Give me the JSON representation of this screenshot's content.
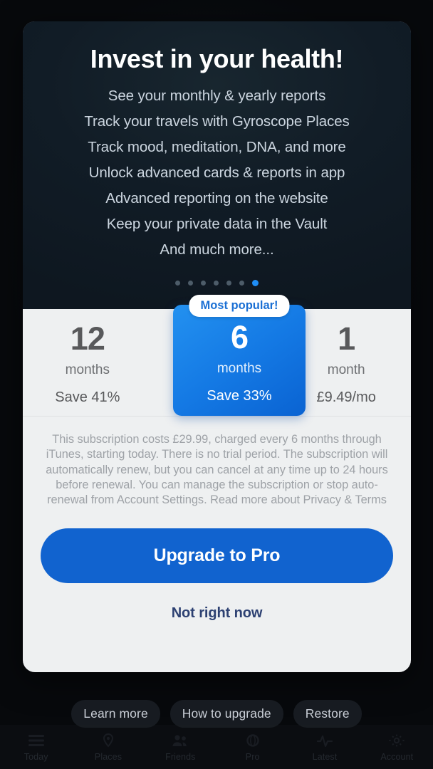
{
  "promo": {
    "title": "Invest in your health!",
    "features": [
      "See your monthly & yearly reports",
      "Track your travels with Gyroscope Places",
      "Track mood, meditation, DNA, and more",
      "Unlock advanced cards & reports in app",
      "Advanced reporting on the website",
      "Keep your private data in the Vault",
      "And much more..."
    ],
    "pager": {
      "total": 7,
      "active_index": 6
    }
  },
  "plans": {
    "badge_label": "Most popular!",
    "options": [
      {
        "number": "12",
        "unit": "months",
        "note": "Save 41%",
        "featured": false
      },
      {
        "number": "6",
        "unit": "months",
        "note": "Save 33%",
        "featured": true
      },
      {
        "number": "1",
        "unit": "month",
        "note": "£9.49/mo",
        "featured": false
      }
    ]
  },
  "disclaimer": "This subscription costs £29.99, charged every 6 months through iTunes, starting today. There is no trial period. The subscription will automatically renew, but you can cancel at any time up to 24 hours before renewal. You can manage the subscription or stop auto-renewal from Account Settings. Read more about Privacy & Terms",
  "actions": {
    "primary_label": "Upgrade to Pro",
    "secondary_label": "Not right now"
  },
  "footer_links": [
    {
      "label": "Learn more"
    },
    {
      "label": "How to upgrade"
    },
    {
      "label": "Restore"
    }
  ],
  "tabbar": {
    "items": [
      {
        "label": "Today",
        "icon": "list-icon"
      },
      {
        "label": "Places",
        "icon": "map-pin-icon"
      },
      {
        "label": "Friends",
        "icon": "people-icon"
      },
      {
        "label": "Pro",
        "icon": "gyroscope-icon"
      },
      {
        "label": "Latest",
        "icon": "activity-icon"
      },
      {
        "label": "Account",
        "icon": "gear-icon"
      }
    ]
  },
  "colors": {
    "accent_blue": "#1163cf",
    "featured_blue": "#1479e4",
    "badge_text": "#1a6fd4",
    "panel_light": "#eef0f1",
    "promo_dark": "#0e1720"
  }
}
